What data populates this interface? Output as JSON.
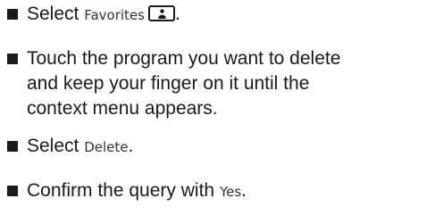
{
  "steps": [
    {
      "prefix": "Select",
      "ui_term": "Favorites",
      "icon": "favorites-icon",
      "suffix": "."
    },
    {
      "line1": "Touch the program you want to delete",
      "line2": "and keep your finger on it until the",
      "line3": "context menu appears."
    },
    {
      "prefix": "Select",
      "ui_term": "Delete",
      "suffix": "."
    },
    {
      "prefix": "Confirm the query with",
      "ui_term": "Yes",
      "suffix": "."
    }
  ]
}
